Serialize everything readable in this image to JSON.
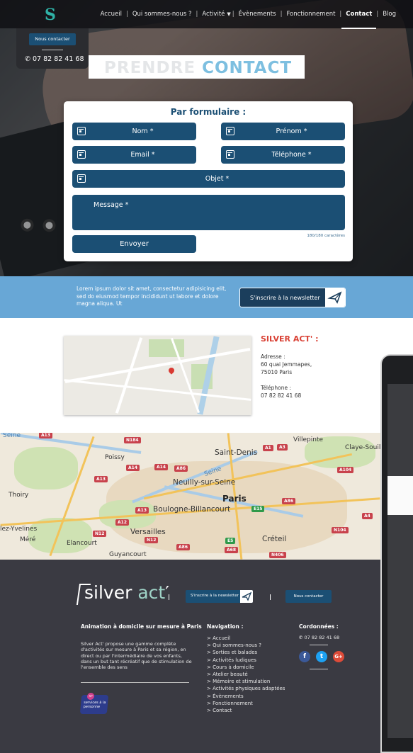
{
  "nav": {
    "items": [
      {
        "label": "Accueil"
      },
      {
        "label": "Qui sommes-nous ?"
      },
      {
        "label": "Activité",
        "caret": "▼"
      },
      {
        "label": "Évènements"
      },
      {
        "label": "Fonctionnement"
      },
      {
        "label": "Contact"
      },
      {
        "label": "Blog"
      }
    ],
    "active": "Contact",
    "separator": "|"
  },
  "header_contact": {
    "button_label": "Nous contacter",
    "phone": "07 82 82 41 68"
  },
  "hero": {
    "title_part1": "PRENDRE",
    "title_part2": "CONTACT"
  },
  "form": {
    "title": "Par formulaire :",
    "fields": {
      "nom": "Nom *",
      "prenom": "Prénom *",
      "email": "Email *",
      "telephone": "Téléphone *",
      "objet": "Objet *",
      "message": "Message *"
    },
    "counter": "180/180 caractères",
    "submit_label": "Envoyer"
  },
  "newsletter": {
    "text": "Lorem ipsum dolor sit amet, consectetur adipisicing elit, sed do eiusmod tempor incididunt ut labore et dolore magna aliqua. Ut",
    "button_label": "S'inscrire à la newsletter"
  },
  "address": {
    "company": "SILVER ACT' :",
    "address_label": "Adresse :",
    "address_line1": "60 quai Jemmapes,",
    "address_line2": "75010 Paris",
    "phone_label": "Téléphone :",
    "phone": "07 82 82 41 68"
  },
  "map": {
    "labels": {
      "villepinte": "Villepinte",
      "saint_denis": "Saint-Denis",
      "claye": "Claye-Souilly",
      "poissy": "Poissy",
      "seine": "Seine",
      "seine_w": "Seine",
      "neuilly": "Neuilly-sur-Seine",
      "paris": "Paris",
      "thoiry": "Thoiry",
      "boulogne": "Boulogne-Billancourt",
      "yvelines": "lez-Yvelines",
      "versailles": "Versailles",
      "mere": "Méré",
      "elancourt": "Elancourt",
      "creteil": "Créteil",
      "guyancourt": "Guyancourt"
    },
    "shields": [
      "A13",
      "N184",
      "A1",
      "A3",
      "A14",
      "A14",
      "A86",
      "A104",
      "A13",
      "A13",
      "E15",
      "A86",
      "A12",
      "A4",
      "N12",
      "N12",
      "A86",
      "E5",
      "A68",
      "N104",
      "N406"
    ]
  },
  "footer": {
    "logo_left": "silver",
    "logo_right": "act",
    "logo_tick": "′",
    "newsletter_label": "S'inscrire à la newsletter",
    "contact_label": "Nous contacter",
    "about_title": "Animation à domicile sur mesure à Paris",
    "about_text": "Silver Act' propose une gamme complète d'activités sur mesure à Paris et sa région, en direct ou par l'intermédiaire de vos enfants, dans un but tant récréatif que de stimulation de l'ensemble des sens",
    "badge_text": "services à la personne",
    "badge_mark": "SP",
    "nav_title": "Navigation :",
    "nav_items": [
      "> Accueil",
      "> Qui sommes-nous ?",
      "> Sorties et balades",
      "> Activités ludiques",
      "> Cours à domicile",
      "> Atelier beauté",
      "> Mémoire et stimulation",
      "> Activités physiques adaptées",
      "> Évènements",
      "> Fonctionnement",
      "> Contact"
    ],
    "coords_title": "Cordonnées :",
    "phone": "07 82 82 41 68",
    "social": [
      {
        "icon": "facebook-icon",
        "glyph": "f",
        "color": "#3b5998"
      },
      {
        "icon": "twitter-icon",
        "glyph": "t",
        "color": "#1da1f2"
      },
      {
        "icon": "google-plus-icon",
        "glyph": "G+",
        "color": "#dd4b39"
      }
    ]
  },
  "colors": {
    "primary": "#1b4f74",
    "accent_red": "#d94135",
    "newsletter_bg": "#68a7d6",
    "footer_bg": "#3a3a42",
    "logo_teal": "#2fb1a6"
  }
}
